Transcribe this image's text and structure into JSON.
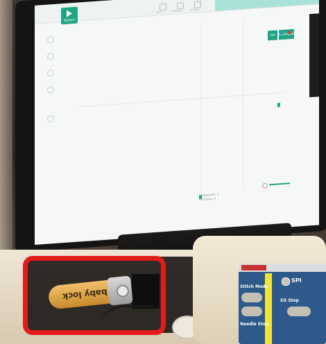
{
  "screen": {
    "logo_label": "Select",
    "toolbar_labels": [
      "Place",
      "Distribute",
      "Settings"
    ],
    "buttons": [
      {
        "label": "⊲⊳"
      },
      {
        "label": "Workspace"
      }
    ],
    "status_lines": [
      "Segments: 0",
      "Stitches: 0"
    ]
  },
  "usb": {
    "brand_text": "baby lock"
  },
  "device": {
    "labels": [
      "SPI",
      "Stitch Mode",
      "Needle Stop",
      "Sit Stop"
    ]
  },
  "colors": {
    "accent": "#1fa583",
    "highlight": "#e21b1b",
    "usb": "#e0a64a"
  }
}
